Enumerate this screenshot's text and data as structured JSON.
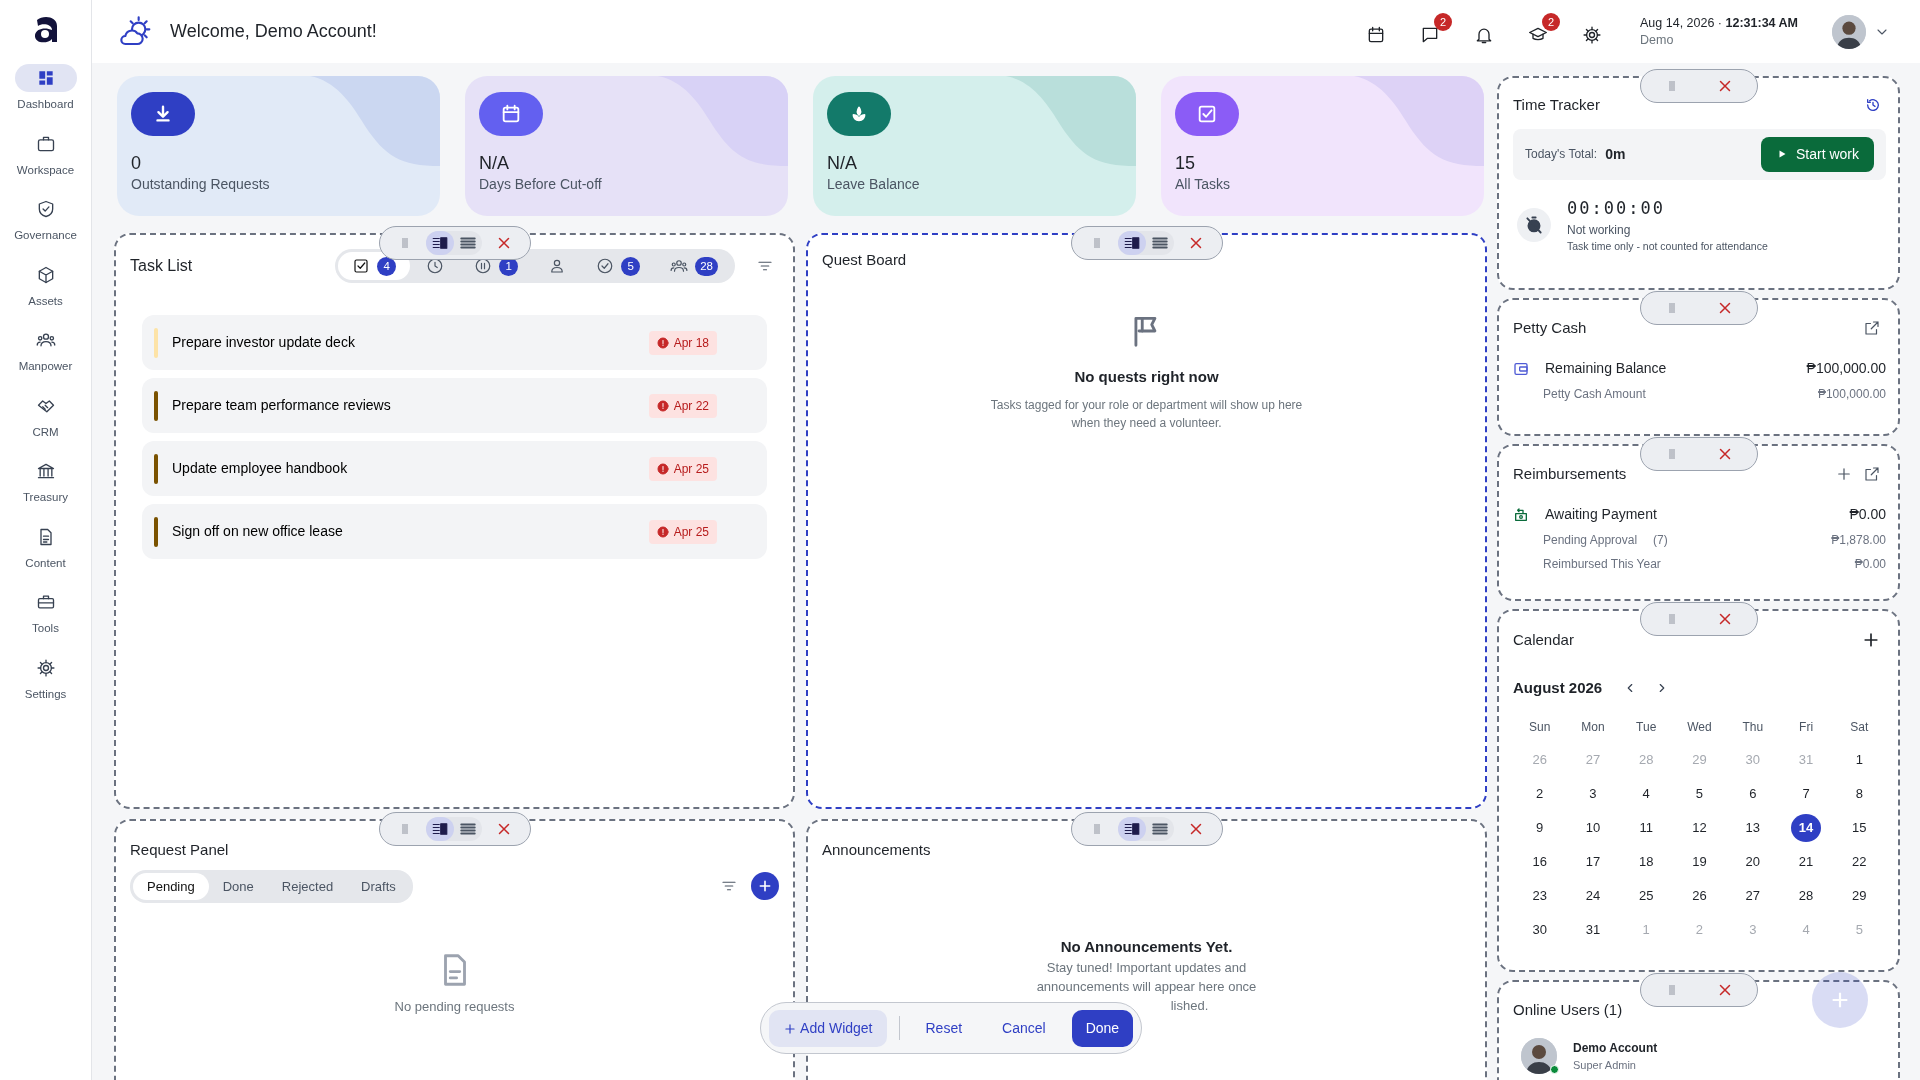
{
  "topbar": {
    "greeting": "Welcome, Demo Account!",
    "icons": [
      {
        "kind": "calendar"
      },
      {
        "kind": "chat",
        "badge": "2"
      },
      {
        "kind": "bell"
      },
      {
        "kind": "cap",
        "badge": "2"
      },
      {
        "kind": "gear"
      }
    ],
    "datetime": "Aug 14, 2026 · **12:31:34 AM**",
    "user": "Demo"
  },
  "sidebar": {
    "items": [
      {
        "label": "Dashboard",
        "selected": true
      },
      {
        "label": "Workspace",
        "selected": false
      },
      {
        "label": "Governance",
        "selected": false
      },
      {
        "label": "Assets",
        "selected": false
      },
      {
        "label": "Manpower",
        "selected": false
      },
      {
        "label": "CRM",
        "selected": false
      },
      {
        "label": "Treasury",
        "selected": false
      },
      {
        "label": "Content",
        "selected": false
      },
      {
        "label": "Tools",
        "selected": false
      },
      {
        "label": "Settings",
        "selected": false
      }
    ]
  },
  "stats": [
    {
      "value": "0",
      "label": "Outstanding Requests",
      "color": "#2f3fc4"
    },
    {
      "value": "N/A",
      "label": "Days Before Cut-off",
      "color": "#6360f0"
    },
    {
      "value": "N/A",
      "label": "Leave Balance",
      "color": "#137a6a"
    },
    {
      "value": "15",
      "label": "All Tasks",
      "color": "#8b5cf6"
    }
  ],
  "task_list": {
    "title": "Task List",
    "split_view": true,
    "active": false,
    "filters": [
      {
        "count": "4",
        "selected": true
      },
      {
        "selected": false
      },
      {
        "count": "1",
        "selected": false
      },
      {
        "selected": false
      },
      {
        "count": "5",
        "selected": false
      },
      {
        "count": "28",
        "selected": false
      }
    ],
    "tasks": [
      {
        "title": "Prepare investor update deck",
        "due": "Apr 18",
        "color": "#fde3a7"
      },
      {
        "title": "Prepare team performance reviews",
        "due": "Apr 22",
        "color": "#7a5200"
      },
      {
        "title": "Update employee handbook",
        "due": "Apr 25",
        "color": "#7a5200"
      },
      {
        "title": "Sign off on new office lease",
        "due": "Apr 25",
        "color": "#7a5200"
      }
    ]
  },
  "quest_board": {
    "title": "Quest Board",
    "split_view": true,
    "active": true,
    "empty_title": "No quests right now",
    "empty_text": "Tasks tagged for your role or department will show up here when they need a volunteer."
  },
  "request_panel": {
    "title": "Request Panel",
    "split_view": true,
    "active": false,
    "tabs": [
      {
        "label": "Pending",
        "selected": true
      },
      {
        "label": "Done",
        "selected": false
      },
      {
        "label": "Rejected",
        "selected": false
      },
      {
        "label": "Drafts",
        "selected": false
      }
    ],
    "empty_text": "No pending requests"
  },
  "announcements": {
    "title": "Announcements",
    "split_view": true,
    "active": false,
    "empty_title": "No Announcements Yet.",
    "lines": [
      "Stay tuned! Important updates and",
      "announcements will appear here once",
      "lished."
    ]
  },
  "time_tracker": {
    "title": "Time Tracker",
    "total_label": "Today's Total:",
    "total": "0m",
    "button": "Start work",
    "clock": "00:00:00",
    "status": "Not working",
    "note": "Task time only - not counted for attendance"
  },
  "petty_cash": {
    "title": "Petty Cash",
    "rows": [
      {
        "label": "Remaining Balance",
        "value": "₱100,000.00",
        "main": true
      },
      {
        "label": "Petty Cash Amount",
        "value": "₱100,000.00",
        "main": false
      }
    ]
  },
  "reimbursements": {
    "title": "Reimbursements",
    "rows": [
      {
        "label": "Awaiting Payment",
        "value": "₱0.00",
        "main": true
      },
      {
        "label": "Pending Approval",
        "count": "(7)",
        "value": "₱1,878.00",
        "main": false
      },
      {
        "label": "Reimbursed This Year",
        "value": "₱0.00",
        "main": false
      }
    ]
  },
  "calendar": {
    "title": "Calendar",
    "month": "August 2026",
    "weekdays": [
      "Sun",
      "Mon",
      "Tue",
      "Wed",
      "Thu",
      "Fri",
      "Sat"
    ],
    "weeks": [
      [
        {
          "day": "26",
          "muted": true,
          "selected": false
        },
        {
          "day": "27",
          "muted": true,
          "selected": false
        },
        {
          "day": "28",
          "muted": true,
          "selected": false
        },
        {
          "day": "29",
          "muted": true,
          "selected": false
        },
        {
          "day": "30",
          "muted": true,
          "selected": false
        },
        {
          "day": "31",
          "muted": true,
          "selected": false
        },
        {
          "day": "1",
          "muted": false,
          "selected": false
        }
      ],
      [
        {
          "day": "2",
          "muted": false,
          "selected": false
        },
        {
          "day": "3",
          "muted": false,
          "selected": false
        },
        {
          "day": "4",
          "muted": false,
          "selected": false
        },
        {
          "day": "5",
          "muted": false,
          "selected": false
        },
        {
          "day": "6",
          "muted": false,
          "selected": false
        },
        {
          "day": "7",
          "muted": false,
          "selected": false
        },
        {
          "day": "8",
          "muted": false,
          "selected": false
        }
      ],
      [
        {
          "day": "9",
          "muted": false,
          "selected": false
        },
        {
          "day": "10",
          "muted": false,
          "selected": false
        },
        {
          "day": "11",
          "muted": false,
          "selected": false
        },
        {
          "day": "12",
          "muted": false,
          "selected": false
        },
        {
          "day": "13",
          "muted": false,
          "selected": false
        },
        {
          "day": "14",
          "muted": false,
          "selected": true
        },
        {
          "day": "15",
          "muted": false,
          "selected": false
        }
      ],
      [
        {
          "day": "16",
          "muted": false,
          "selected": false
        },
        {
          "day": "17",
          "muted": false,
          "selected": false
        },
        {
          "day": "18",
          "muted": false,
          "selected": false
        },
        {
          "day": "19",
          "muted": false,
          "selected": false
        },
        {
          "day": "20",
          "muted": false,
          "selected": false
        },
        {
          "day": "21",
          "muted": false,
          "selected": false
        },
        {
          "day": "22",
          "muted": false,
          "selected": false
        }
      ],
      [
        {
          "day": "23",
          "muted": false,
          "selected": false
        },
        {
          "day": "24",
          "muted": false,
          "selected": false
        },
        {
          "day": "25",
          "muted": false,
          "selected": false
        },
        {
          "day": "26",
          "muted": false,
          "selected": false
        },
        {
          "day": "27",
          "muted": false,
          "selected": false
        },
        {
          "day": "28",
          "muted": false,
          "selected": false
        },
        {
          "day": "29",
          "muted": false,
          "selected": false
        }
      ],
      [
        {
          "day": "30",
          "muted": false,
          "selected": false
        },
        {
          "day": "31",
          "muted": false,
          "selected": false
        },
        {
          "day": "1",
          "muted": true,
          "selected": false
        },
        {
          "day": "2",
          "muted": true,
          "selected": false
        },
        {
          "day": "3",
          "muted": true,
          "selected": false
        },
        {
          "day": "4",
          "muted": true,
          "selected": false
        },
        {
          "day": "5",
          "muted": true,
          "selected": false
        }
      ]
    ]
  },
  "online_users": {
    "title": "Online Users (1)",
    "users": [
      {
        "name": "Demo Account",
        "role": "Super Admin",
        "online": true
      }
    ]
  },
  "action_bar": {
    "buttons": [
      {
        "label": "Add Widget",
        "kind": "add"
      },
      {
        "label": "Reset",
        "kind": "text"
      },
      {
        "label": "Cancel",
        "kind": "text"
      },
      {
        "label": "Done",
        "kind": "primary"
      }
    ]
  }
}
